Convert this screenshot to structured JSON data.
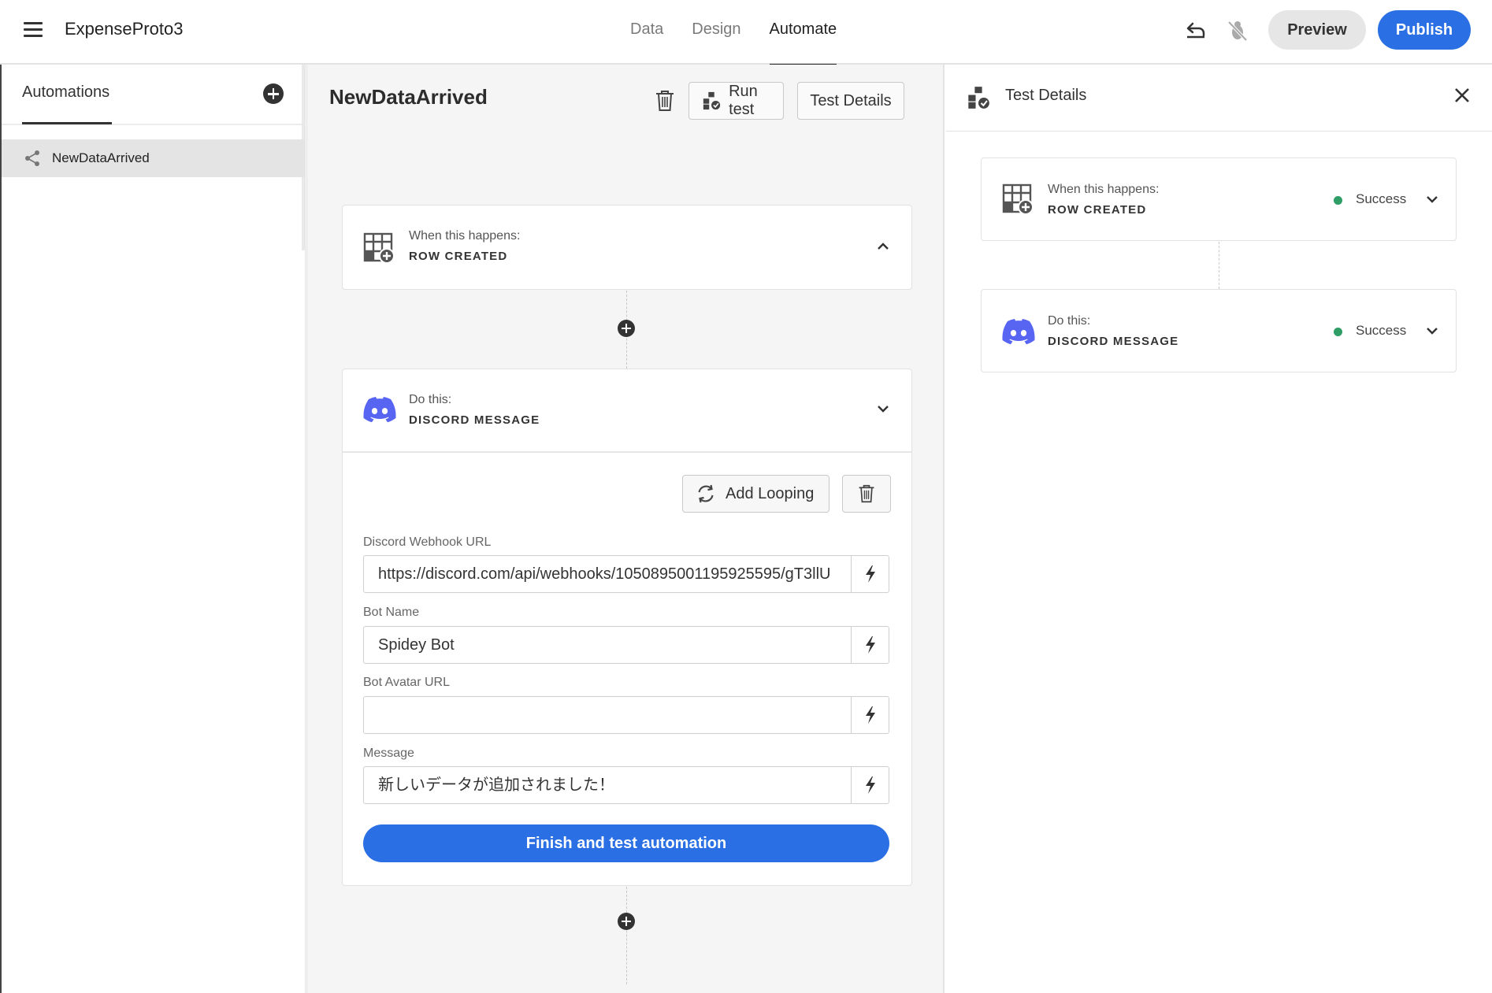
{
  "app": {
    "title": "ExpenseProto3",
    "tabs": [
      {
        "label": "Data",
        "active": false
      },
      {
        "label": "Design",
        "active": false
      },
      {
        "label": "Automate",
        "active": true
      }
    ],
    "preview_label": "Preview",
    "publish_label": "Publish",
    "accent_color": "#2a6fe3"
  },
  "sidebar": {
    "header": "Automations",
    "items": [
      {
        "label": "NewDataArrived",
        "icon": "share-icon",
        "selected": true
      }
    ]
  },
  "editor": {
    "title": "NewDataArrived",
    "run_test_label": "Run test",
    "test_details_label": "Test Details",
    "trigger": {
      "label": "When this happens:",
      "value": "ROW CREATED",
      "icon": "table-add-icon",
      "expanded": false
    },
    "action": {
      "label": "Do this:",
      "value": "DISCORD MESSAGE",
      "icon": "discord-icon",
      "expanded": true,
      "add_looping_label": "Add Looping",
      "fields": [
        {
          "label": "Discord Webhook URL",
          "value": "https://discord.com/api/webhooks/1050895001195925595/gT3llU"
        },
        {
          "label": "Bot Name",
          "value": "Spidey Bot"
        },
        {
          "label": "Bot Avatar URL",
          "value": ""
        },
        {
          "label": "Message",
          "value": "新しいデータが追加されました！"
        }
      ],
      "finish_label": "Finish and test automation"
    }
  },
  "test_panel": {
    "title": "Test Details",
    "results": [
      {
        "label": "When this happens:",
        "value": "ROW CREATED",
        "icon": "table-add-icon",
        "status": "Success"
      },
      {
        "label": "Do this:",
        "value": "DISCORD MESSAGE",
        "icon": "discord-icon",
        "status": "Success"
      }
    ],
    "status_color": "#2e9e66"
  }
}
